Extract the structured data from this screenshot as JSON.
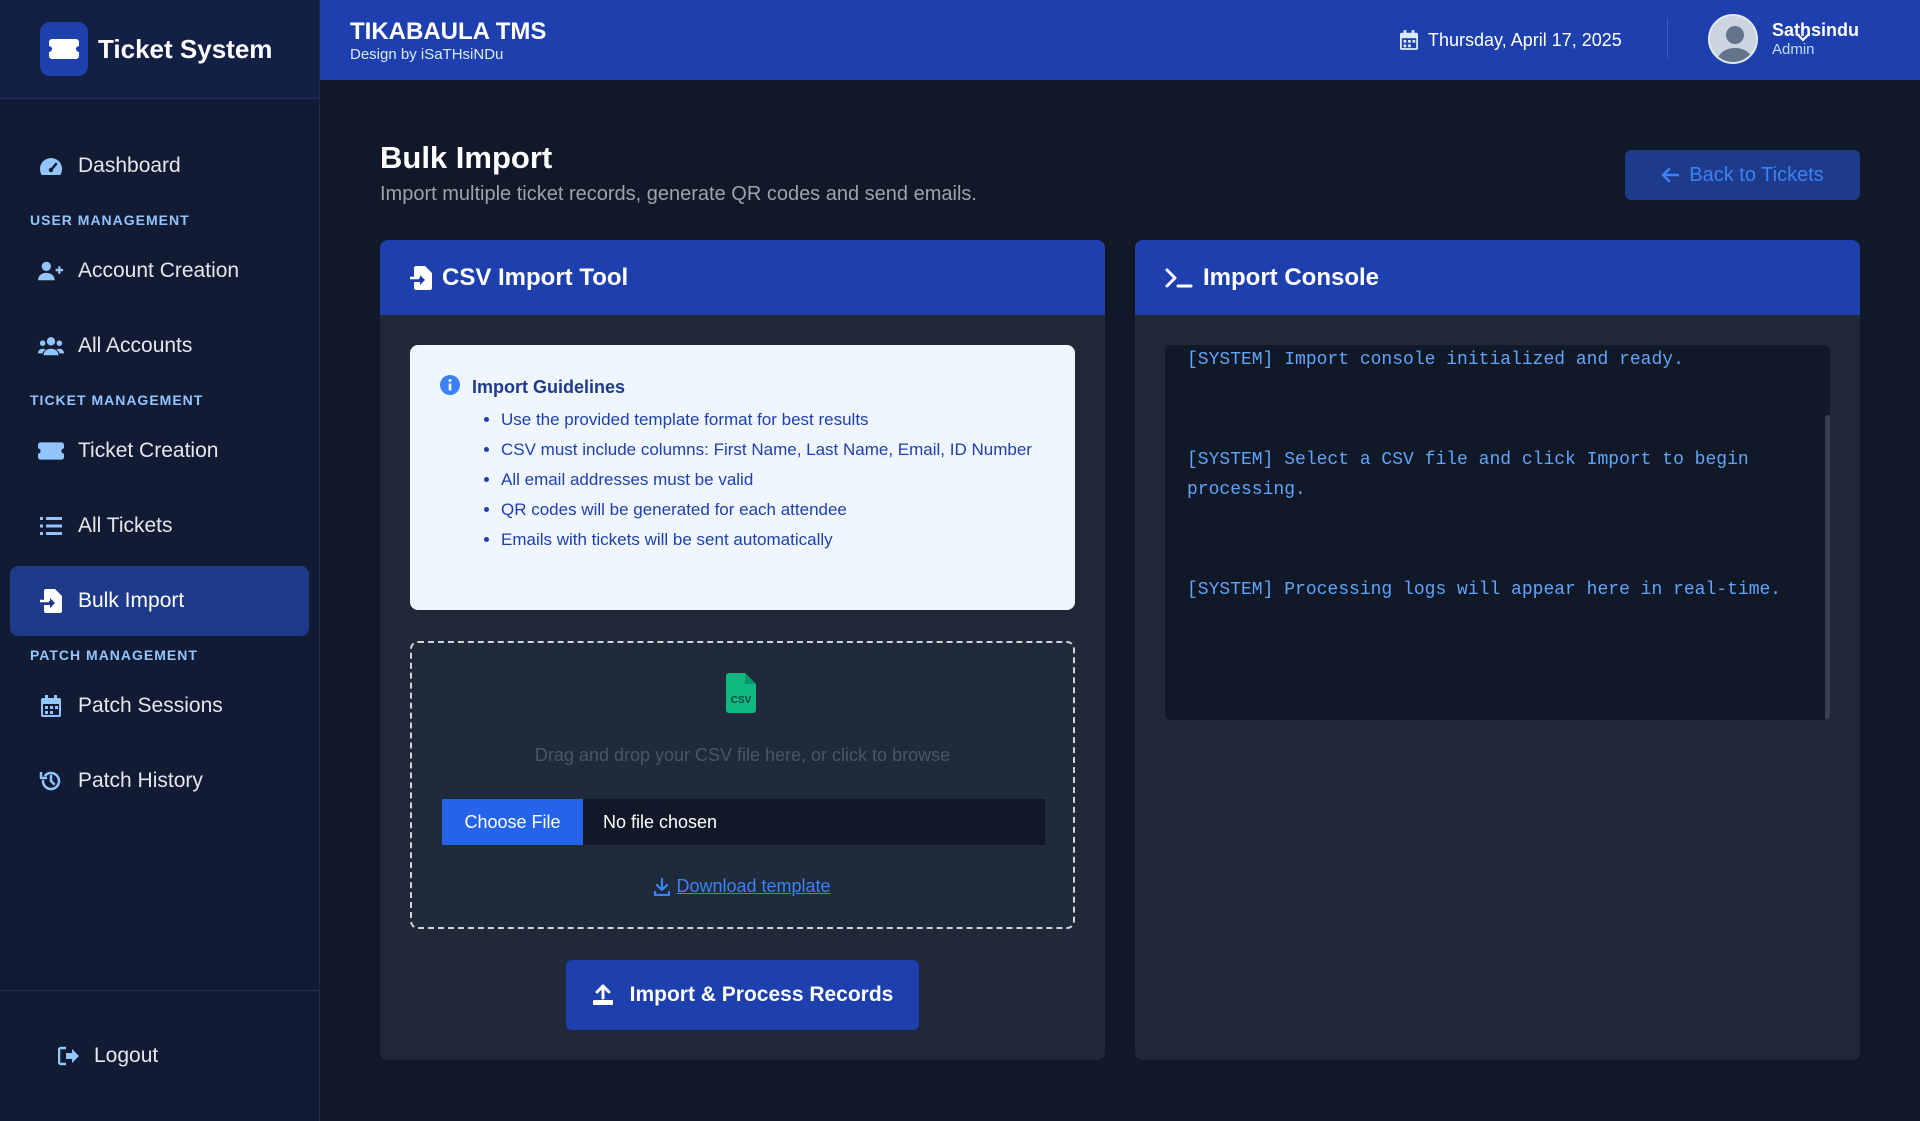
{
  "sidebar": {
    "brand": "Ticket System",
    "dashboard": "Dashboard",
    "section_user": "USER MANAGEMENT",
    "account_creation": "Account Creation",
    "all_accounts": "All Accounts",
    "section_ticket": "TICKET MANAGEMENT",
    "ticket_creation": "Ticket Creation",
    "all_tickets": "All Tickets",
    "bulk_import": "Bulk Import",
    "section_patch": "PATCH MANAGEMENT",
    "patch_sessions": "Patch Sessions",
    "patch_history": "Patch History",
    "logout": "Logout"
  },
  "header": {
    "title": "TIKABAULA TMS",
    "subtitle": "Design by iSaTHsiNDu",
    "date": "Thursday, April 17, 2025",
    "user_name": "Sathsindu",
    "user_role": "Admin"
  },
  "page": {
    "title": "Bulk Import",
    "subtitle": "Import multiple ticket records, generate QR codes and send emails.",
    "back_button": "Back to Tickets"
  },
  "import_tool": {
    "title": "CSV Import Tool",
    "guidelines_title": "Import Guidelines",
    "guidelines": [
      "Use the provided template format for best results",
      "CSV must include columns: First Name, Last Name, Email, ID Number",
      "All email addresses must be valid",
      "QR codes will be generated for each attendee",
      "Emails with tickets will be sent automatically"
    ],
    "drop_text": "Drag and drop your CSV file here, or click to browse",
    "choose_file": "Choose File",
    "no_file": "No file chosen",
    "download_template": "Download template",
    "import_button": "Import & Process Records"
  },
  "console": {
    "title": "Import Console",
    "lines": [
      "[SYSTEM] Import console initialized and ready.",
      "[SYSTEM] Select a CSV file and click Import to begin processing.",
      "[SYSTEM] Processing logs will appear here in real-time."
    ]
  },
  "colors": {
    "accent": "#1e40af",
    "sidebar_bg": "#111b33",
    "page_bg": "#111827",
    "card_bg": "#1f2937",
    "console_text": "#60a5fa"
  }
}
